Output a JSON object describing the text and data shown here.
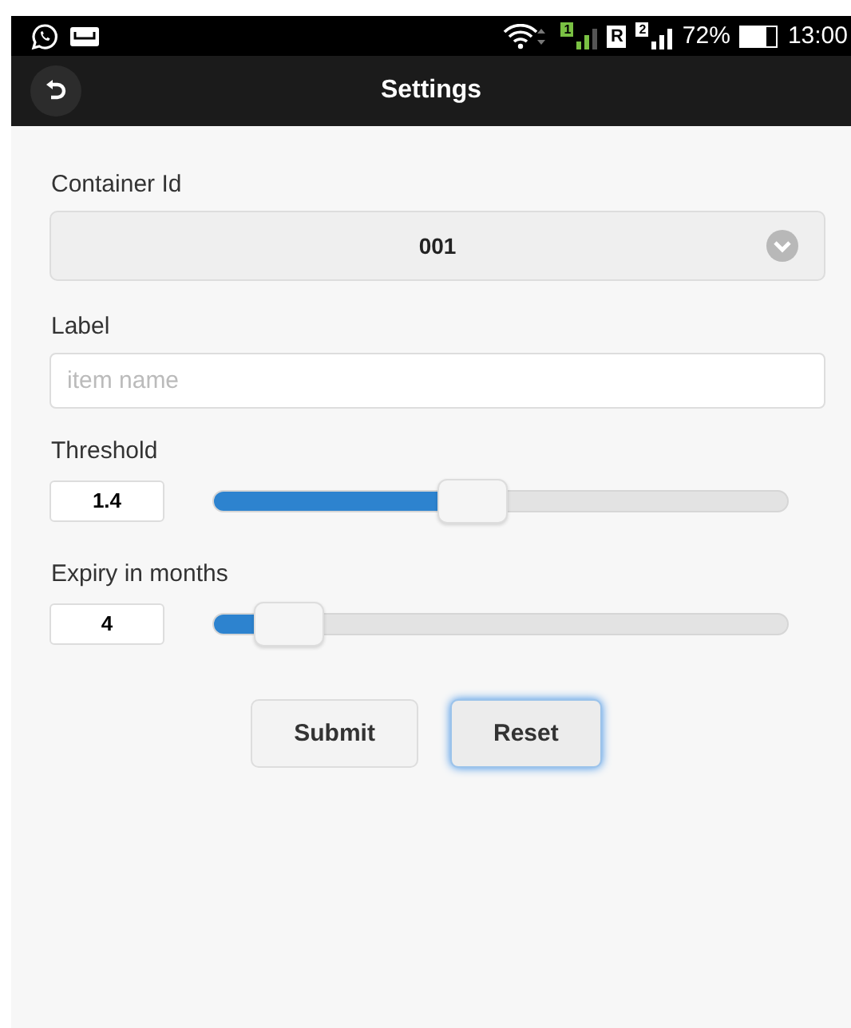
{
  "status_bar": {
    "sims": [
      {
        "slot": "1",
        "active": true
      },
      {
        "slot": "2",
        "active": false
      }
    ],
    "roaming": "R",
    "battery": "72%",
    "time": "13:00"
  },
  "header": {
    "title": "Settings"
  },
  "form": {
    "container": {
      "label": "Container Id",
      "value": "001"
    },
    "text_field": {
      "label": "Label",
      "placeholder": "item name"
    },
    "sliders": [
      {
        "label": "Threshold",
        "value": "1.4",
        "level": 0.45
      },
      {
        "label": "Expiry in months",
        "value": "4",
        "level": 0.13
      }
    ],
    "buttons": [
      {
        "label": "Submit",
        "focused": false
      },
      {
        "label": "Reset",
        "focused": true
      }
    ]
  }
}
